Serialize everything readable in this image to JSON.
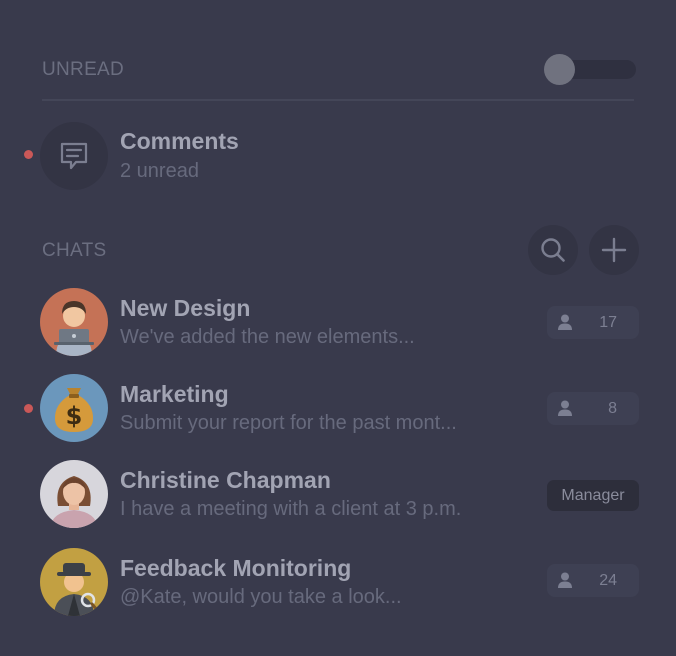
{
  "unread": {
    "title": "UNREAD",
    "toggle_on": false,
    "item": {
      "title": "Comments",
      "subtitle": "2 unread",
      "icon": "comment-icon",
      "has_unread_dot": true
    }
  },
  "chats": {
    "title": "CHATS",
    "actions": [
      {
        "icon": "search-icon"
      },
      {
        "icon": "plus-icon"
      }
    ],
    "items": [
      {
        "title": "New Design",
        "preview": "We've added the new elements...",
        "avatar": "developer-emoji-avatar",
        "badge_type": "members",
        "count": "17",
        "unread": false
      },
      {
        "title": "Marketing",
        "preview": "Submit your report for the past mont...",
        "avatar": "money-bag-emoji-avatar",
        "badge_type": "members",
        "count": "8",
        "unread": true
      },
      {
        "title": "Christine Chapman",
        "preview": "I have a meeting with a client at 3 p.m.",
        "avatar": "christine-photo-avatar",
        "badge_type": "role",
        "role": "Manager",
        "unread": false
      },
      {
        "title": "Feedback Monitoring",
        "preview": "@Kate, would you take a look...",
        "avatar": "detective-emoji-avatar",
        "badge_type": "members",
        "count": "24",
        "unread": false
      }
    ]
  },
  "colors": {
    "background": "#393a4c",
    "unread_dot": "#ca5858",
    "badge": "#3e4053",
    "role_badge": "#2d2e3b"
  }
}
